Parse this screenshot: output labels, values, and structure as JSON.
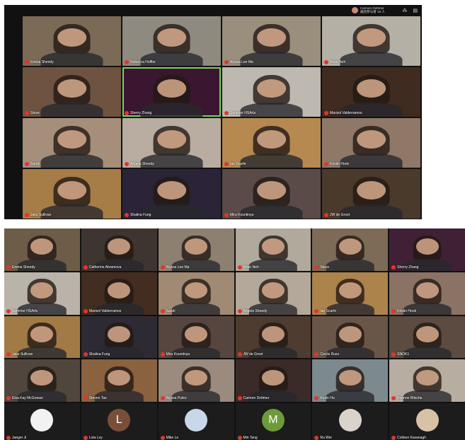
{
  "screenshot_top": {
    "owner": {
      "name": "Carmen Dettmer",
      "status": "通話参与者 16 人"
    },
    "tiles": [
      {
        "name": "Emma Sheedy",
        "bg": "#7b6a55"
      },
      {
        "name": "Rebecca Hoffler",
        "bg": "#8f8a80"
      },
      {
        "name": "Alyssa Lee Ma",
        "bg": "#9a8e7c"
      },
      {
        "name": "Brian Neh",
        "bg": "#b5b0a5"
      },
      {
        "name": "Steve",
        "bg": "#6e5340"
      },
      {
        "name": "Sherry Zhang",
        "bg": "#3a1630",
        "speaking": true
      },
      {
        "name": "Summer HSArts",
        "bg": "#bdb8b0"
      },
      {
        "name": "Marisol Valderramos",
        "bg": "#3f2b1f"
      },
      {
        "name": "Sandi",
        "bg": "#a58f7a"
      },
      {
        "name": "Angela Sheedy",
        "bg": "#b8ada0"
      },
      {
        "name": "Ian Scarfe",
        "bg": "#b58950"
      },
      {
        "name": "Kristin Hook",
        "bg": "#8f7868"
      },
      {
        "name": "Jake Sullivan",
        "bg": "#a67d47"
      },
      {
        "name": "Shalina Fung",
        "bg": "#2b2438"
      },
      {
        "name": "Mira Kountinya",
        "bg": "#5a4a48"
      },
      {
        "name": "JW de Groot",
        "bg": "#4a3a2c"
      }
    ]
  },
  "screenshot_bottom": {
    "tiles": [
      {
        "name": "Emma Sheedy",
        "bg": "#6d5c48"
      },
      {
        "name": "Catherine Abramova",
        "bg": "#3f3530"
      },
      {
        "name": "Alyssa Lee Ma",
        "bg": "#8e8070"
      },
      {
        "name": "Brian Neh",
        "bg": "#b0a99c"
      },
      {
        "name": "Steve",
        "bg": "#7d6a57"
      },
      {
        "name": "Sherry Zhang",
        "bg": "#402035"
      },
      {
        "name": "Summer HSArts",
        "bg": "#b9b3aa"
      },
      {
        "name": "Marisol Valderramos",
        "bg": "#432d20"
      },
      {
        "name": "Sandi",
        "bg": "#a08a74"
      },
      {
        "name": "Angela Sheedy",
        "bg": "#b3a899"
      },
      {
        "name": "Ian Scarfe",
        "bg": "#ad834c"
      },
      {
        "name": "Kristin Hook",
        "bg": "#8a7364"
      },
      {
        "name": "Jake Sullivan",
        "bg": "#a27a45"
      },
      {
        "name": "Shalina Fung",
        "bg": "#2e2a33"
      },
      {
        "name": "Mira Kountinya",
        "bg": "#57463f"
      },
      {
        "name": "JW de Groot",
        "bg": "#4d3c2f"
      },
      {
        "name": "Cecile Russ",
        "bg": "#6a5648"
      },
      {
        "name": "SNOK1",
        "bg": "#5b4b40"
      },
      {
        "name": "Elsa Kay McGowan",
        "bg": "#51463e"
      },
      {
        "name": "Steven Tao",
        "bg": "#8a6240"
      },
      {
        "name": "Alyssa Puleo",
        "bg": "#9a8b7e"
      },
      {
        "name": "Carmen Dettmer",
        "bg": "#3b2b28"
      },
      {
        "name": "Kevin Hu",
        "bg": "#7c8a8e"
      },
      {
        "name": "Brianne Ritsche",
        "bg": "#b7ada1"
      }
    ],
    "avatars": [
      {
        "name": "Jaeger Ji",
        "initial": "",
        "bg": "#f2f2f2"
      },
      {
        "name": "Lola Loy",
        "initial": "L",
        "bg": "#7a4f3a"
      },
      {
        "name": "Mike Le",
        "initial": "",
        "bg": "#c8d8e8"
      },
      {
        "name": "Min Tang",
        "initial": "M",
        "bg": "#6e9b3a"
      },
      {
        "name": "Ru Wei",
        "initial": "",
        "bg": "#d9d3cc"
      },
      {
        "name": "Colleen Kavanagh",
        "initial": "",
        "bg": "#d7c2a6"
      }
    ]
  }
}
